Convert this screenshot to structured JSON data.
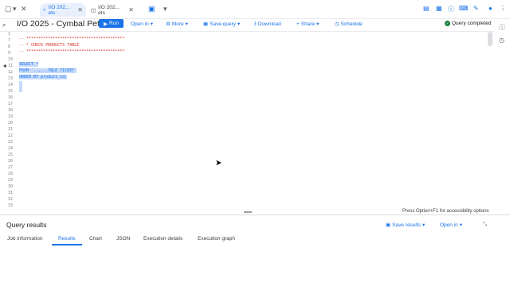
{
  "browser": {
    "tabs": [
      {
        "label": "I/O 202... ets",
        "active": true
      },
      {
        "label": "I/O 202... ets",
        "active": false
      }
    ]
  },
  "header": {
    "title": "I/O 2025 - Cymbal Pets",
    "run_label": "Run",
    "open_in_label": "Open in",
    "more_label": "More",
    "save_query_label": "Save query",
    "download_label": "Download",
    "share_label": "Share",
    "schedule_label": "Schedule",
    "status_label": "Query completed"
  },
  "editor": {
    "line_numbers": [
      "1",
      "7",
      "8",
      "9",
      "10",
      "11",
      "12",
      "13",
      "14",
      "15",
      "16",
      "17",
      "18",
      "19",
      "20",
      "21",
      "22",
      "23",
      "24",
      "25",
      "26",
      "27",
      "28",
      "29",
      "30",
      "31",
      "32",
      "33"
    ],
    "comment_lines": [
      "-- *****************************************",
      "-- * CHECK PRODUCTS TABLE",
      "-- *****************************************"
    ],
    "selected_lines": [
      "SELECT *",
      "FROM `......TBLE TICKET`",
      "ORDER BY product_id;"
    ],
    "accessibility_hint": "Press Option+F1 for accessibility options"
  },
  "results": {
    "title": "Query results",
    "save_results_label": "Save results",
    "open_in_label": "Open in",
    "tabs": [
      "Job information",
      "Results",
      "Chart",
      "JSON",
      "Execution details",
      "Execution graph"
    ],
    "active_tab": "Results"
  },
  "colors": {
    "accent": "#1a73e8",
    "selection": "#c6dafc",
    "comment": "#d93025",
    "success": "#188038"
  }
}
